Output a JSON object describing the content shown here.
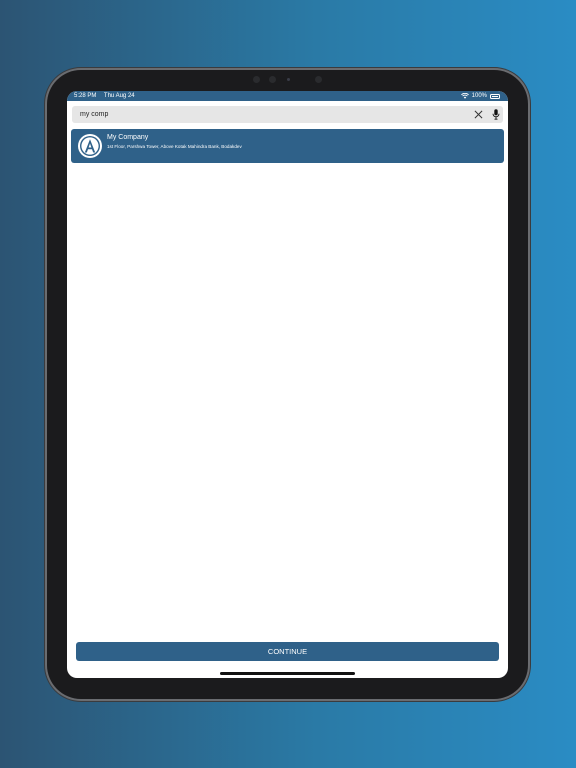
{
  "status_bar": {
    "time": "5:28 PM",
    "date": "Thu Aug 24",
    "battery": "100%",
    "wifi_icon": "wifi-icon",
    "battery_icon": "battery-icon"
  },
  "search": {
    "value": "my comp",
    "placeholder": "",
    "clear_icon": "close-icon",
    "mic_icon": "microphone-icon"
  },
  "results": [
    {
      "name": "My Company",
      "address": "1st Floor, Parshwa Tower, Above Kotak Mahindra Bank, Bodakdev",
      "logo_icon": "company-logo-a-icon"
    }
  ],
  "continue_label": "CONTINUE",
  "colors": {
    "primary": "#2f6189",
    "background_left": "#2c5473",
    "background_right": "#2a8cc4"
  }
}
